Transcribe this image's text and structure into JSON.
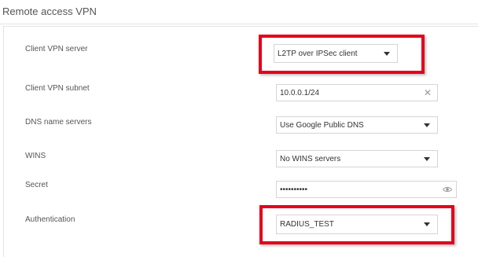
{
  "section": {
    "title": "Remote access VPN"
  },
  "form": {
    "client_vpn_server": {
      "label": "Client VPN server",
      "value": "L2TP over IPSec client"
    },
    "client_vpn_subnet": {
      "label": "Client VPN subnet",
      "value": "10.0.0.1/24"
    },
    "dns_name_servers": {
      "label": "DNS name servers",
      "value": "Use Google Public DNS"
    },
    "wins": {
      "label": "WINS",
      "value": "No WINS servers"
    },
    "secret": {
      "label": "Secret",
      "value": "••••••••••"
    },
    "authentication": {
      "label": "Authentication",
      "value": "RADIUS_TEST"
    }
  },
  "icons": {
    "dropdown": "chevron-down-icon",
    "clear": "close-icon",
    "reveal": "eye-icon"
  },
  "colors": {
    "highlight": "#e3001b",
    "border": "#d5d5d5",
    "label": "#555555"
  }
}
